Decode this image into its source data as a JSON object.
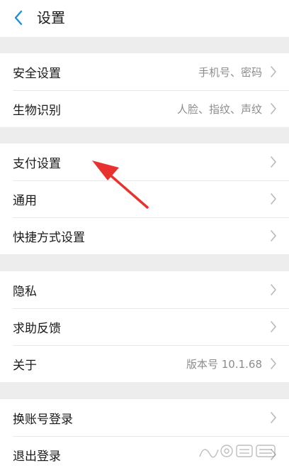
{
  "header": {
    "title": "设置"
  },
  "groups": [
    {
      "items": [
        {
          "label": "安全设置",
          "value": "手机号、密码"
        },
        {
          "label": "生物识别",
          "value": "人脸、指纹、声纹"
        }
      ]
    },
    {
      "items": [
        {
          "label": "支付设置",
          "value": ""
        },
        {
          "label": "通用",
          "value": ""
        },
        {
          "label": "快捷方式设置",
          "value": ""
        }
      ]
    },
    {
      "items": [
        {
          "label": "隐私",
          "value": ""
        },
        {
          "label": "求助反馈",
          "value": ""
        },
        {
          "label": "关于",
          "value": "版本号 10.1.68"
        }
      ]
    },
    {
      "items": [
        {
          "label": "换账号登录",
          "value": ""
        },
        {
          "label": "退出登录",
          "value": ""
        }
      ]
    }
  ],
  "icons": {
    "back": "chevron-left-icon",
    "row_chevron": "chevron-right-icon"
  },
  "colors": {
    "back_icon": "#1e8fd6",
    "annotation_arrow": "#e8322e",
    "divider_background": "#ededed"
  }
}
